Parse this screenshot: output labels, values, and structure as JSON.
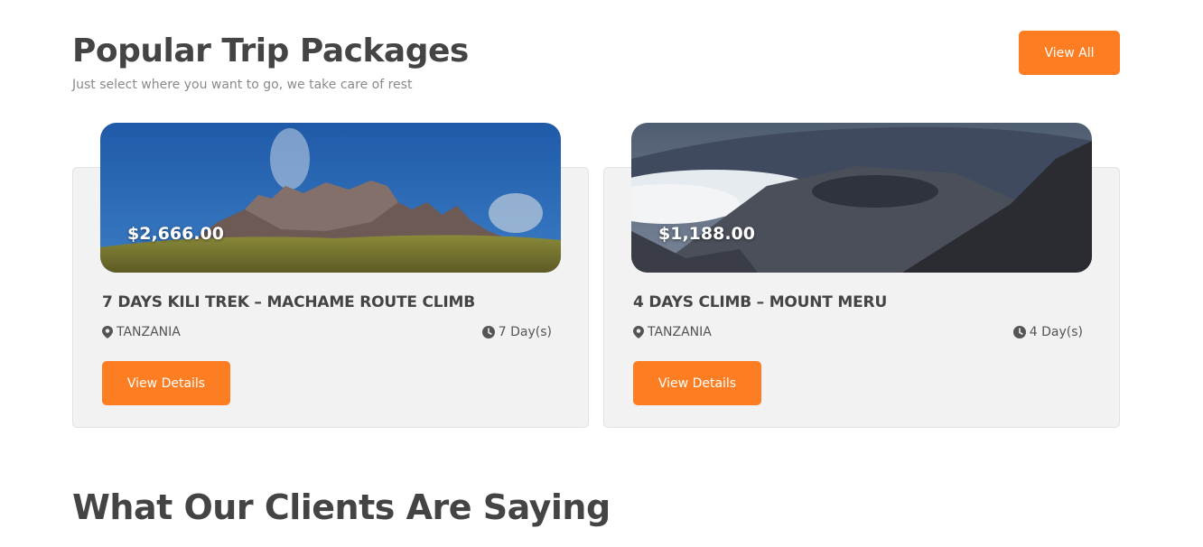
{
  "section": {
    "title": "Popular Trip Packages",
    "subtitle": "Just select where you want to go, we take care of rest",
    "view_all_label": "View All"
  },
  "packages": [
    {
      "price": "$2,666.00",
      "title": "7 DAYS KILI TREK – MACHAME ROUTE CLIMB",
      "location": "TANZANIA",
      "duration": "7 Day(s)",
      "button_label": "View Details",
      "image": "mountain-peaks-blue-sky"
    },
    {
      "price": "$1,188.00",
      "title": "4 DAYS CLIMB – MOUNT MERU",
      "location": "TANZANIA",
      "duration": "4 Day(s)",
      "button_label": "View Details",
      "image": "volcanic-crater-clouds"
    }
  ],
  "testimonials": {
    "title": "What Our Clients Are Saying"
  },
  "colors": {
    "accent": "#fd7e22",
    "heading": "#444444",
    "card_bg": "#f2f2f2"
  },
  "icons": {
    "location": "map-pin-icon",
    "duration": "clock-icon"
  }
}
